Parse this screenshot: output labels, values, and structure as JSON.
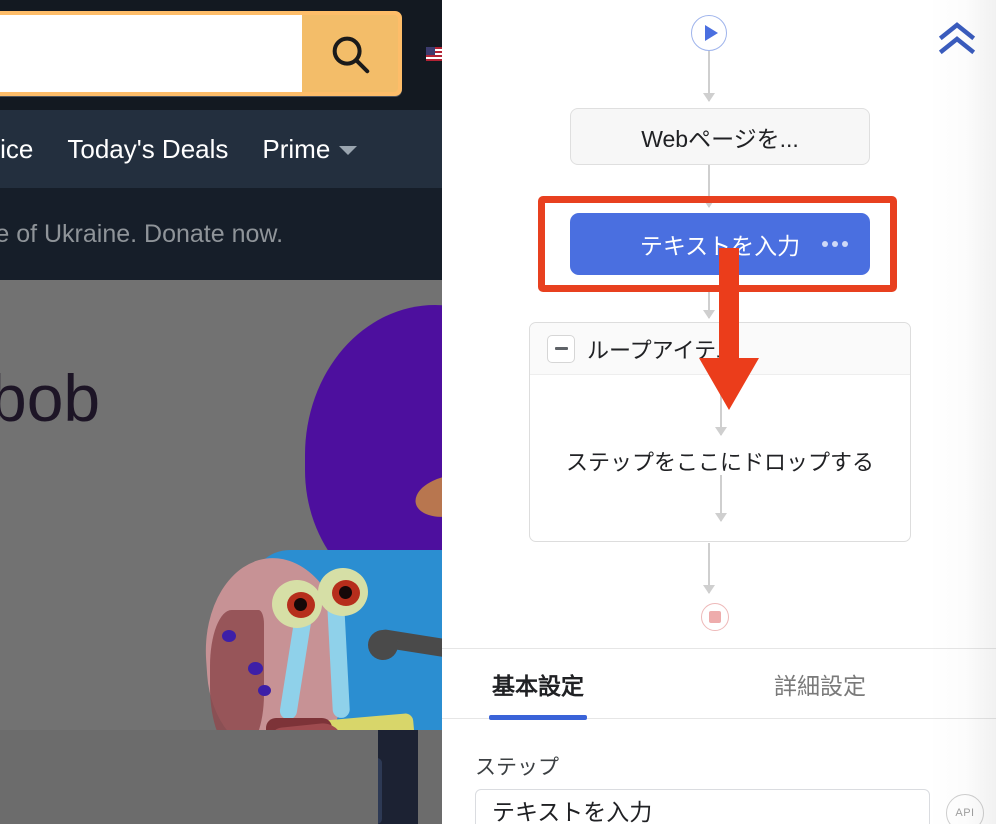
{
  "webpage": {
    "search": {
      "value": "",
      "placeholder": "",
      "icon": "search-icon"
    },
    "flag_icon": "us-flag-icon",
    "nav": [
      {
        "label": "ervice"
      },
      {
        "label": "Today's Deals"
      },
      {
        "label": "Prime",
        "has_caret": true
      }
    ],
    "banner_text": "ople of Ukraine. Donate now.",
    "hero_title": "bob"
  },
  "panel": {
    "collapse_icon": "double-chevron-up-icon",
    "flow": {
      "start_node": {
        "icon": "play-icon"
      },
      "steps": [
        {
          "label": "Webページを...",
          "type": "gray"
        },
        {
          "label": "テキストを入力",
          "type": "blue-selected",
          "menu_icon": "ellipsis-icon",
          "highlighted": true
        }
      ],
      "loop": {
        "title": "ループアイテム",
        "toggle_icon": "minus-icon",
        "drop_hint": "ステップをここにドロップする"
      },
      "end_node": {
        "icon": "stop-icon"
      }
    },
    "annotation": {
      "arrow": "red-down-arrow",
      "color": "#e8401f"
    },
    "tabs": [
      {
        "label": "基本設定",
        "active": true
      },
      {
        "label": "詳細設定",
        "active": false
      }
    ],
    "form": {
      "step_label": "ステップ",
      "step_value": "テキストを入力",
      "api_badge": "API"
    }
  },
  "colors": {
    "accent_blue": "#4a6fe0",
    "tab_underline": "#3a63d8",
    "annotation_red": "#e8401f",
    "amazon_orange": "#febd69",
    "amazon_dark": "#131921",
    "amazon_nav": "#232f3e"
  }
}
